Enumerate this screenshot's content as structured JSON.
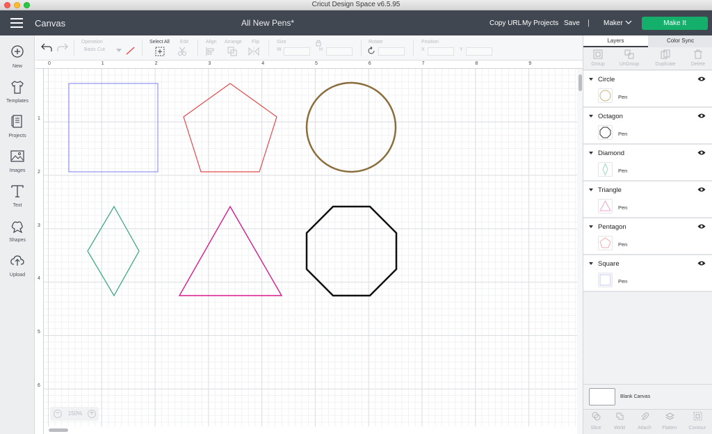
{
  "window": {
    "title": "Cricut Design Space  v6.5.95"
  },
  "header": {
    "app_name": "Canvas",
    "project_name": "All New Pens*",
    "copy_url": "Copy URL",
    "my_projects": "My Projects",
    "save": "Save",
    "separator": "|",
    "machine": "Maker",
    "make_it": "Make It"
  },
  "sidebar": {
    "items": [
      {
        "label": "New",
        "icon": "plus-circle-icon"
      },
      {
        "label": "Templates",
        "icon": "tshirt-icon"
      },
      {
        "label": "Projects",
        "icon": "projects-icon"
      },
      {
        "label": "Images",
        "icon": "image-icon"
      },
      {
        "label": "Text",
        "icon": "text-icon"
      },
      {
        "label": "Shapes",
        "icon": "shapes-icon"
      },
      {
        "label": "Upload",
        "icon": "upload-icon"
      }
    ]
  },
  "toolbar": {
    "operation_label": "Operation",
    "operation_value": "Basic Cut",
    "select_all": "Select All",
    "edit": "Edit",
    "align": "Align",
    "arrange": "Arrange",
    "flip": "Flip",
    "size": "Size",
    "size_w": "W",
    "size_h": "H",
    "rotate": "Rotate",
    "position": "Position",
    "pos_x": "X",
    "pos_y": "Y"
  },
  "rulers": {
    "top": [
      "0",
      "1",
      "2",
      "3",
      "4",
      "5",
      "6",
      "7",
      "8",
      "9"
    ],
    "left": [
      "1",
      "2",
      "3",
      "4",
      "5",
      "6"
    ]
  },
  "canvas": {
    "zoom_level": "150%",
    "zoom_in": "+",
    "zoom_out": "−"
  },
  "panel": {
    "tabs": {
      "layers": "Layers",
      "color_sync": "Color Sync"
    },
    "tools": [
      "Group",
      "UnGroup",
      "Duplicate",
      "Delete"
    ],
    "layers": [
      {
        "name": "Circle",
        "sub": "Pen",
        "color": "#8a6d3b"
      },
      {
        "name": "Octagon",
        "sub": "Pen",
        "color": "#111111"
      },
      {
        "name": "Diamond",
        "sub": "Pen",
        "color": "#2fa47a"
      },
      {
        "name": "Triangle",
        "sub": "Pen",
        "color": "#d81b8c"
      },
      {
        "name": "Pentagon",
        "sub": "Pen",
        "color": "#e4484b"
      },
      {
        "name": "Square",
        "sub": "Pen",
        "color": "#7c7cf0"
      }
    ],
    "blank_canvas": "Blank Canvas",
    "bottom_tools": [
      "Slice",
      "Weld",
      "Attach",
      "Flatten",
      "Contour"
    ]
  }
}
